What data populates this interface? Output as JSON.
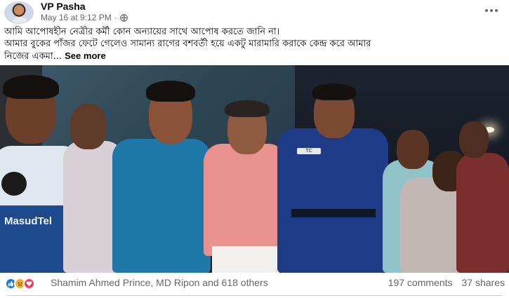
{
  "post": {
    "author": "VP Pasha",
    "timestamp": "May 16 at 9:12 PM",
    "separator": "·",
    "privacy_icon": "globe-icon",
    "more_icon": "more-horizontal-icon",
    "text_lines": [
      "আমি আপোষহীন  নেত্রীর কর্মী কোন অন্যায়ের সাথে আপোষ করতে জানি না।",
      "আমার বুকের পাঁজর ফেটে গেলেও সামান্য রাগের বশবর্তী হয়ে একটু মারামারি   করাকে কেন্দ্র করে আমার",
      "নিজের একমা..."
    ],
    "see_more": "See more",
    "jersey_text": "MasudTel",
    "badge_text": "TC"
  },
  "footer": {
    "reaction_icons": [
      "like-icon",
      "sad-icon",
      "love-icon"
    ],
    "reacted_by": "Shamim Ahmed Prince, MD Ripon and 618 others",
    "comments": "197 comments",
    "shares": "37 shares"
  },
  "colors": {
    "text_primary": "#050505",
    "text_secondary": "#65676b",
    "like_blue": "#1877f2",
    "love_red": "#f33e58",
    "sad_yellow": "#f7b125",
    "divider": "#ced0d4"
  }
}
